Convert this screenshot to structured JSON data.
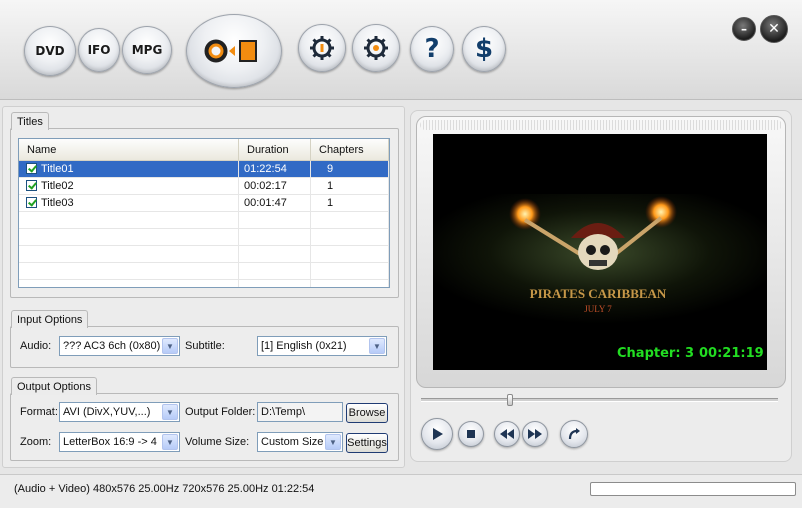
{
  "toolbar": {
    "dvd_label": "DVD",
    "ifo_label": "IFO",
    "mpg_label": "MPG",
    "help_label": "?",
    "buy_label": "$",
    "minimize_label": "–",
    "close_label": "✕"
  },
  "titles": {
    "tab_label": "Titles",
    "columns": {
      "name": "Name",
      "duration": "Duration",
      "chapters": "Chapters"
    },
    "rows": [
      {
        "name": "Title01",
        "duration": "01:22:54",
        "chapters": "9"
      },
      {
        "name": "Title02",
        "duration": "00:02:17",
        "chapters": "1"
      },
      {
        "name": "Title03",
        "duration": "00:01:47",
        "chapters": "1"
      }
    ]
  },
  "input_options": {
    "tab_label": "Input Options",
    "audio_label": "Audio:",
    "audio_value": "??? AC3 6ch (0x80)",
    "subtitle_label": "Subtitle:",
    "subtitle_value": "[1] English (0x21)"
  },
  "output_options": {
    "tab_label": "Output Options",
    "format_label": "Format:",
    "format_value": "AVI (DivX,YUV,...)",
    "output_folder_label": "Output Folder:",
    "output_folder_value": "D:\\Temp\\",
    "browse_label": "Browse",
    "zoom_label": "Zoom:",
    "zoom_value": "LetterBox 16:9 -> 4",
    "volume_size_label": "Volume Size:",
    "volume_size_value": "Custom Size",
    "settings_label": "Settings"
  },
  "preview": {
    "chapter_text": "Chapter: 3",
    "time_text": "00:21:19",
    "overlay_color": "#22dd22",
    "seek_fraction": 0.25,
    "poster_title": "PIRATES CARIBBEAN",
    "poster_date": "JULY 7"
  },
  "status": {
    "text": "(Audio + Video) 480x576 25.00Hz 720x576 25.00Hz 01:22:54",
    "progress": 0
  }
}
